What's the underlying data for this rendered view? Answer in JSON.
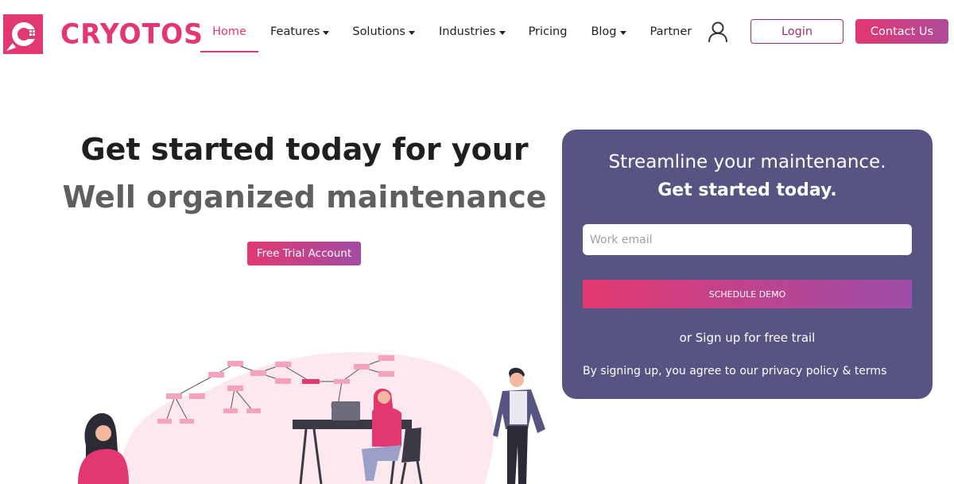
{
  "header": {
    "brand_name": "CRYOTOS",
    "nav": [
      {
        "label": "Home",
        "active": true,
        "dropdown": false
      },
      {
        "label": "Features",
        "active": false,
        "dropdown": true
      },
      {
        "label": "Solutions",
        "active": false,
        "dropdown": true
      },
      {
        "label": "Industries",
        "active": false,
        "dropdown": true
      },
      {
        "label": "Pricing",
        "active": false,
        "dropdown": false
      },
      {
        "label": "Blog",
        "active": false,
        "dropdown": true
      },
      {
        "label": "Partner",
        "active": false,
        "dropdown": false
      }
    ],
    "user_icon": "user-icon",
    "login_label": "Login",
    "contact_label": "Contact Us"
  },
  "hero": {
    "line1": "Get started today for your",
    "line2": "Well organized maintenance",
    "cta_label": "Free Trial Account"
  },
  "signup": {
    "title_line1": "Streamline your maintenance.",
    "title_line2": "Get started today.",
    "email_placeholder": "Work email",
    "email_value": "",
    "submit_label": "SCHEDULE DEMO",
    "alt_link": "or Sign up for free trail",
    "terms": "By signing up, you agree to our privacy policy & terms"
  },
  "colors": {
    "brand": "#e2386f",
    "card_bg": "#565483",
    "gradient_end": "#9d4eaa"
  }
}
